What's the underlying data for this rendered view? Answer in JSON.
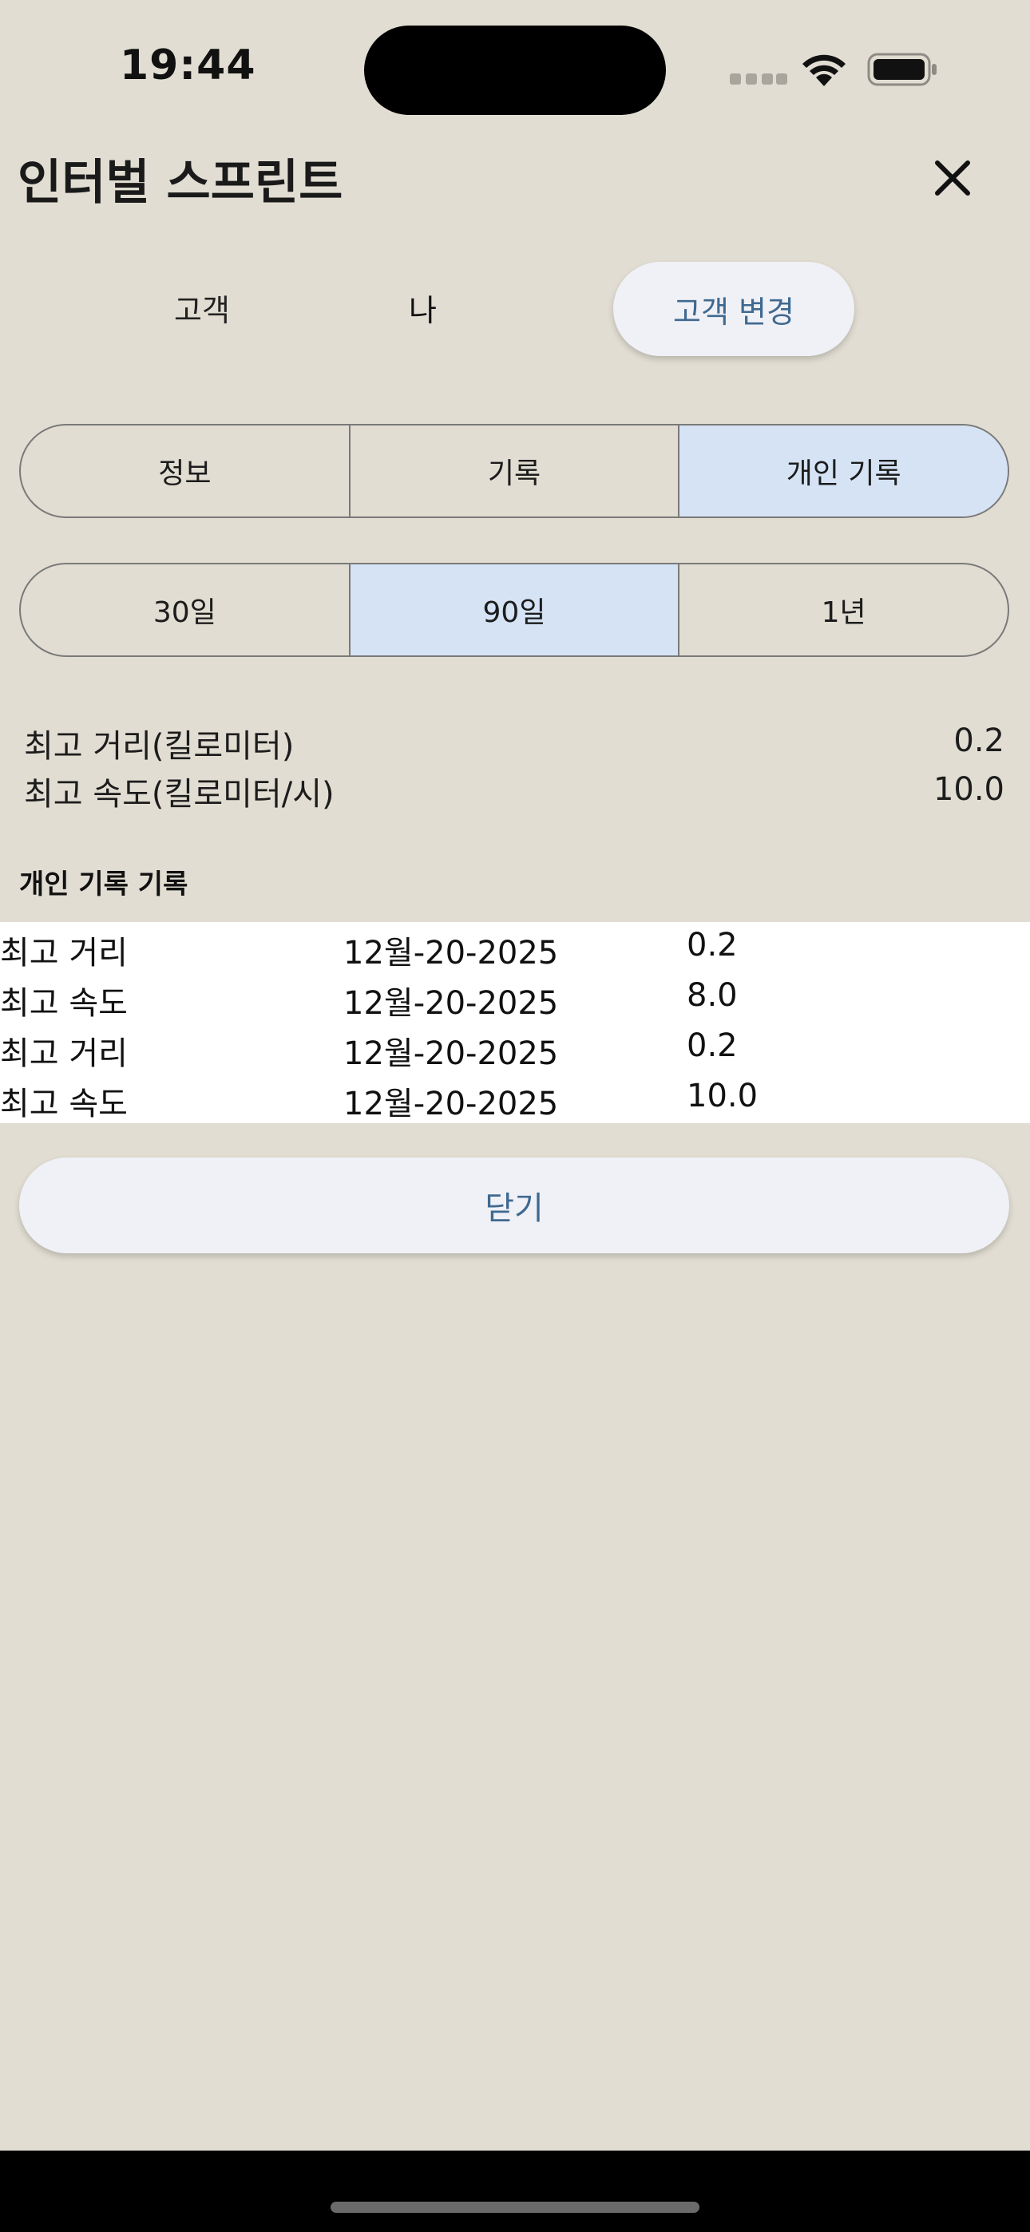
{
  "status_bar": {
    "time": "19:44"
  },
  "header": {
    "title": "인터벌 스프린트",
    "close_icon": "close-icon"
  },
  "client": {
    "label": "고객",
    "name": "나",
    "change_button": "고객 변경"
  },
  "tabs": {
    "items": [
      "정보",
      "기록",
      "개인 기록"
    ],
    "selected": "개인 기록"
  },
  "period": {
    "items": [
      "30일",
      "90일",
      "1년"
    ],
    "selected": "90일"
  },
  "stats": [
    {
      "label": "최고 거리(킬로미터)",
      "value": "0.2"
    },
    {
      "label": "최고 속도(킬로미터/시)",
      "value": "10.0"
    }
  ],
  "records": {
    "title": "개인 기록 기록",
    "rows": [
      {
        "type": "최고 거리",
        "date": "12월-20-2025",
        "value": "0.2"
      },
      {
        "type": "최고 속도",
        "date": "12월-20-2025",
        "value": "8.0"
      },
      {
        "type": "최고 거리",
        "date": "12월-20-2025",
        "value": "0.2"
      },
      {
        "type": "최고 속도",
        "date": "12월-20-2025",
        "value": "10.0"
      }
    ]
  },
  "footer": {
    "close_button": "닫기"
  },
  "colors": {
    "background": "#e1ddd2",
    "selected_segment": "#d5e3f5",
    "button_bg": "#f0f1f6",
    "button_text": "#3f6990"
  }
}
